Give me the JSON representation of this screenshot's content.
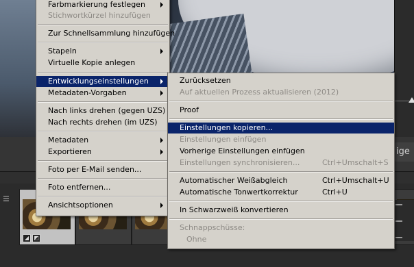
{
  "background": {
    "right_button_label": "ige"
  },
  "context_menu": {
    "items": [
      {
        "label": "Farbmarkierung festlegen",
        "disabled": false
      },
      {
        "label": "Stichwortkürzel hinzufügen",
        "disabled": true
      },
      {
        "label": "Zur Schnellsammlung hinzufügen",
        "disabled": false
      },
      {
        "label": "Stapeln",
        "disabled": false
      },
      {
        "label": "Virtuelle Kopie anlegen",
        "disabled": false
      },
      {
        "label": "Entwicklungseinstellungen",
        "disabled": false
      },
      {
        "label": "Metadaten-Vorgaben",
        "disabled": false
      },
      {
        "label": "Nach links drehen (gegen UZS)",
        "disabled": false
      },
      {
        "label": "Nach rechts drehen (im UZS)",
        "disabled": false
      },
      {
        "label": "Metadaten",
        "disabled": false
      },
      {
        "label": "Exportieren",
        "disabled": false
      },
      {
        "label": "Foto per E-Mail senden...",
        "disabled": false
      },
      {
        "label": "Foto entfernen...",
        "disabled": false
      },
      {
        "label": "Ansichtsoptionen",
        "disabled": false
      }
    ]
  },
  "submenu": {
    "items": [
      {
        "label": "Zurücksetzen",
        "shortcut": ""
      },
      {
        "label": "Auf aktuellen Prozess aktualisieren (2012)",
        "shortcut": ""
      },
      {
        "label": "Proof",
        "shortcut": ""
      },
      {
        "label": "Einstellungen kopieren...",
        "shortcut": ""
      },
      {
        "label": "Einstellungen einfügen",
        "shortcut": ""
      },
      {
        "label": "Vorherige Einstellungen einfügen",
        "shortcut": ""
      },
      {
        "label": "Einstellungen synchronisieren...",
        "shortcut": "Ctrl+Umschalt+S"
      },
      {
        "label": "Automatischer Weißabgleich",
        "shortcut": "Ctrl+Umschalt+U"
      },
      {
        "label": "Automatische Tonwertkorrektur",
        "shortcut": "Ctrl+U"
      },
      {
        "label": "In Schwarzweiß konvertieren",
        "shortcut": ""
      },
      {
        "label": "Schnappschüsse:",
        "shortcut": ""
      },
      {
        "label": "Ohne",
        "shortcut": ""
      }
    ]
  },
  "colors": {
    "highlight": "#0a246a",
    "menu_bg": "#d5d2cb",
    "disabled_text": "#8d8a85"
  }
}
